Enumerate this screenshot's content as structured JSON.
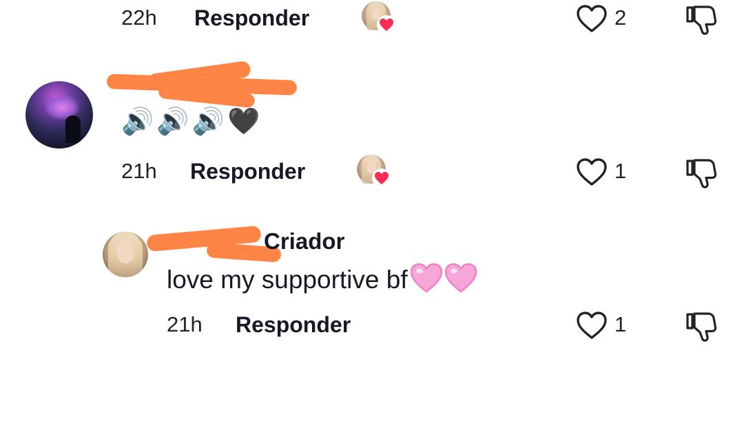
{
  "colors": {
    "redaction": "#ff8547",
    "creator_heart": "#fe2c55",
    "pink_heart": "#f7a6d8"
  },
  "top_reply_row": {
    "time": "22h",
    "reply_label": "Responder",
    "like_count": "2",
    "icons": [
      "creator-liked-avatar",
      "heart-outline-icon",
      "dislike-icon"
    ]
  },
  "comment": {
    "author": "",
    "text_emojis": [
      "🔊",
      "🔊",
      "🔊",
      "🖤"
    ],
    "time": "21h",
    "reply_label": "Responder",
    "like_count": "1"
  },
  "reply": {
    "author_badge": "Criador",
    "text": "love my supportive bf",
    "text_emojis": [
      "pink-heart",
      "pink-heart"
    ],
    "time": "21h",
    "reply_label": "Responder",
    "like_count": "1"
  }
}
